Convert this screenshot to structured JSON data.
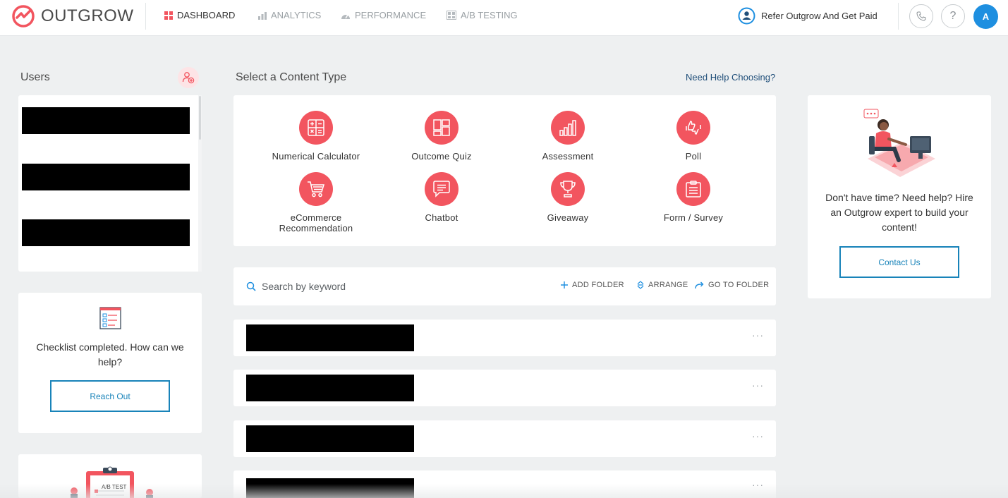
{
  "app": {
    "logo_text": "OUTGROW",
    "brand_color": "#f2555f",
    "accent_color": "#1883b9"
  },
  "nav": [
    {
      "label": "DASHBOARD",
      "icon": "dashboard-grid-icon",
      "active": true
    },
    {
      "label": "ANALYTICS",
      "icon": "bar-chart-icon",
      "active": false
    },
    {
      "label": "PERFORMANCE",
      "icon": "speedometer-icon",
      "active": false
    },
    {
      "label": "A/B TESTING",
      "icon": "ab-test-icon",
      "active": false
    }
  ],
  "header": {
    "refer_label": "Refer Outgrow And Get Paid",
    "phone_icon": "phone-icon",
    "help_label": "?",
    "avatar_initial": "A"
  },
  "users": {
    "title": "Users",
    "add_icon": "add-user-icon"
  },
  "checklist": {
    "icon": "checklist-icon",
    "text": "Checklist completed. How can we help?",
    "button_label": "Reach Out"
  },
  "ab_test_promo": {
    "label": "A/B TEST"
  },
  "content_types": {
    "title": "Select a Content Type",
    "help_link": "Need Help Choosing?",
    "items": [
      {
        "label": "Numerical Calculator",
        "icon": "calculator-icon"
      },
      {
        "label": "Outcome Quiz",
        "icon": "quiz-grid-icon"
      },
      {
        "label": "Assessment",
        "icon": "assessment-bars-icon"
      },
      {
        "label": "Poll",
        "icon": "poll-thumbs-icon"
      },
      {
        "label": "eCommerce Recommendation",
        "icon": "cart-icon"
      },
      {
        "label": "Chatbot",
        "icon": "chat-icon"
      },
      {
        "label": "Giveaway",
        "icon": "trophy-icon"
      },
      {
        "label": "Form / Survey",
        "icon": "clipboard-icon"
      }
    ]
  },
  "toolbar": {
    "search_placeholder": "Search by keyword",
    "add_folder": "ADD FOLDER",
    "arrange": "ARRANGE",
    "go_to_folder": "GO TO FOLDER"
  },
  "content_rows": [
    {
      "more": "···"
    },
    {
      "more": "···"
    },
    {
      "more": "···"
    },
    {
      "more": "···"
    }
  ],
  "expert": {
    "text": "Don't have time? Need help? Hire an Outgrow expert to build your content!",
    "button_label": "Contact Us"
  }
}
